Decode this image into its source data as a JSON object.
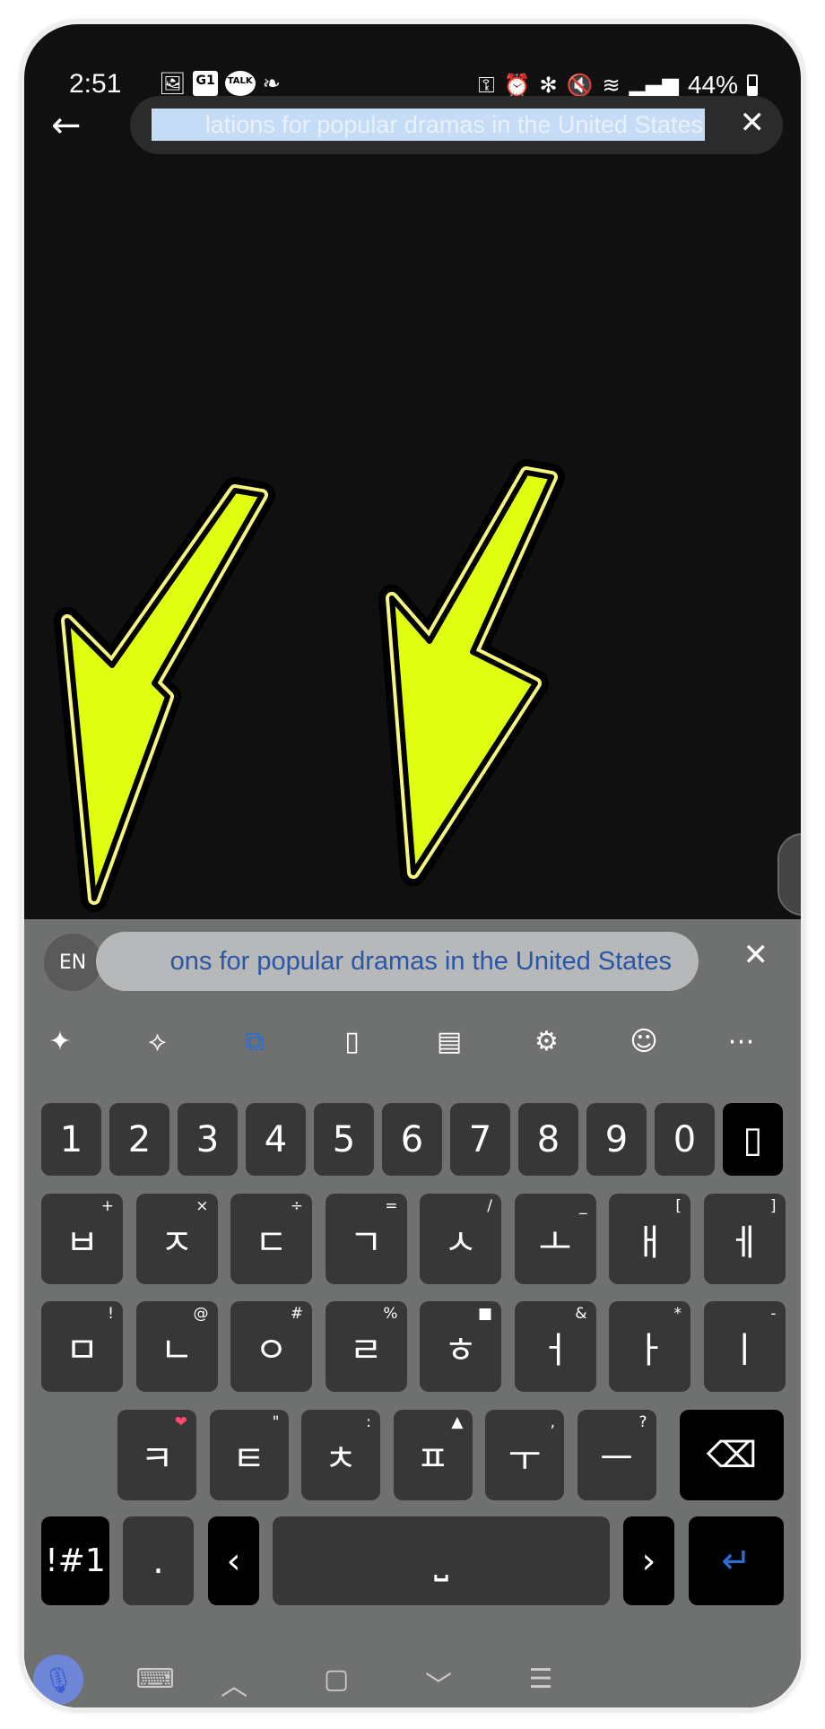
{
  "status": {
    "time": "2:51",
    "left_icons": [
      "gallery-icon",
      "g1-icon",
      "kakaotalk-icon",
      "chat-bubble-icon"
    ],
    "talk": "TALK",
    "g1": "G1",
    "right_icons": [
      "key-icon",
      "alarm-icon",
      "bluetooth-icon",
      "mute-icon",
      "wifi-icon",
      "signal-icon"
    ],
    "battery": "44%",
    "battery_level": 44
  },
  "search": {
    "value": "lations for popular dramas in the United States",
    "selected": true
  },
  "keyboard": {
    "lang": "EN",
    "suggestion": "ons for popular dramas in the United States",
    "toolbar": [
      "sparkle-icon",
      "text-edit-icon",
      "translate-icon",
      "clipboard-icon",
      "keypad-icon",
      "settings-icon",
      "emoji-icon",
      "more-icon"
    ],
    "accent": "#2a56a4",
    "numbers": [
      "1",
      "2",
      "3",
      "4",
      "5",
      "6",
      "7",
      "8",
      "9",
      "0"
    ],
    "row2": [
      {
        "k": "ㅂ",
        "s": "+"
      },
      {
        "k": "ㅈ",
        "s": "×"
      },
      {
        "k": "ㄷ",
        "s": "÷"
      },
      {
        "k": "ㄱ",
        "s": "="
      },
      {
        "k": "ㅅ",
        "s": "/"
      },
      {
        "k": "ㅗ",
        "s": "_"
      },
      {
        "k": "ㅐ",
        "s": "["
      },
      {
        "k": "ㅔ",
        "s": "]"
      }
    ],
    "row3": [
      {
        "k": "ㅁ",
        "s": "!"
      },
      {
        "k": "ㄴ",
        "s": "@"
      },
      {
        "k": "ㅇ",
        "s": "#"
      },
      {
        "k": "ㄹ",
        "s": "%"
      },
      {
        "k": "ㅎ",
        "s": "■"
      },
      {
        "k": "ㅓ",
        "s": "&"
      },
      {
        "k": "ㅏ",
        "s": "*"
      },
      {
        "k": "ㅣ",
        "s": "-"
      }
    ],
    "row4": [
      {
        "k": "ㅋ",
        "s": "❤"
      },
      {
        "k": "ㅌ",
        "s": "\""
      },
      {
        "k": "ㅊ",
        "s": ":"
      },
      {
        "k": "ㅍ",
        "s": "▲"
      },
      {
        "k": "ㅜ",
        "s": ","
      },
      {
        "k": "ㅡ",
        "s": "?"
      }
    ],
    "sym": "!#1",
    "period": ".",
    "left": "‹",
    "right": "›",
    "space": "⎵",
    "enter": "↵",
    "backspace": "⌫"
  },
  "arrow_color": "#e0ff10"
}
